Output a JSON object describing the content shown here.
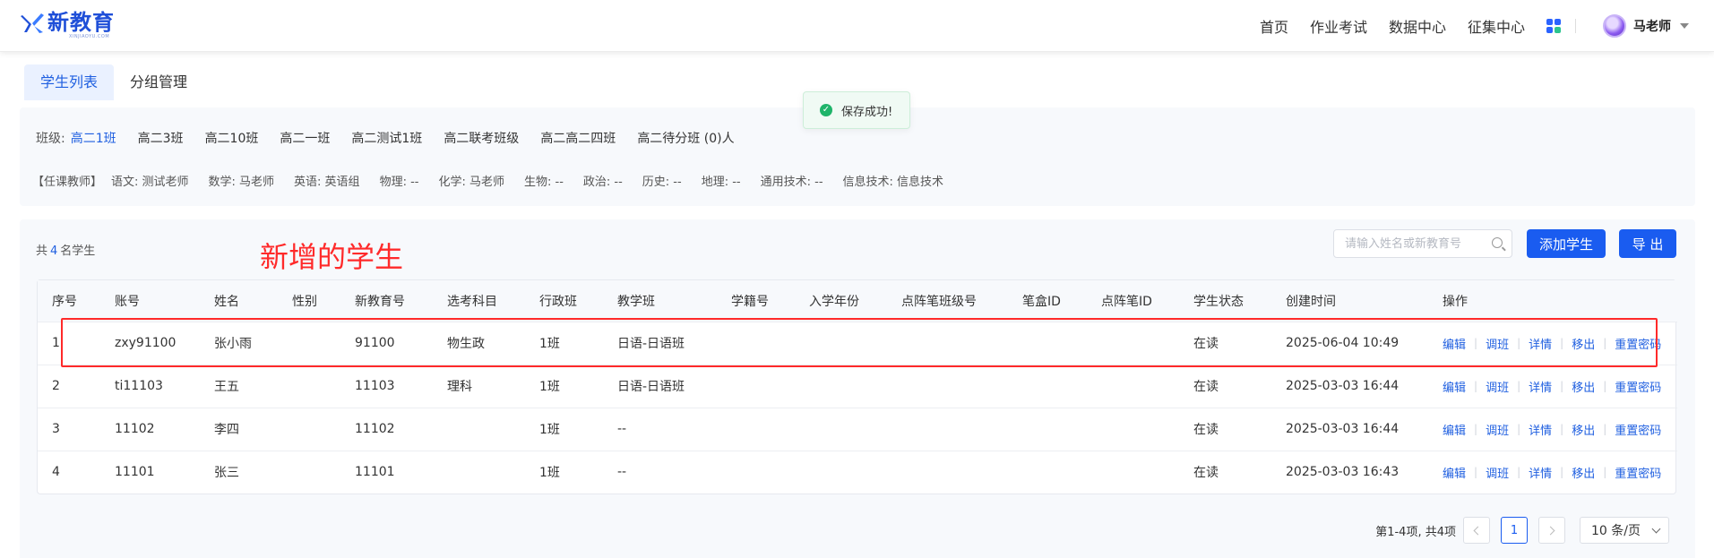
{
  "header": {
    "logo_text": "新教育",
    "logo_subtext": "XINJIAOYU.COM",
    "nav": [
      "首页",
      "作业考试",
      "数据中心",
      "征集中心"
    ],
    "user_name": "马老师"
  },
  "tabs": [
    {
      "label": "学生列表",
      "active": true
    },
    {
      "label": "分组管理",
      "active": false
    }
  ],
  "toast": {
    "message": "保存成功!"
  },
  "classes": {
    "label": "班级:",
    "items": [
      "高二1班",
      "高二3班",
      "高二10班",
      "高二一班",
      "高二测试1班",
      "高二联考班级",
      "高二高二四班",
      "高二待分班 (0)人"
    ],
    "active_index": 0
  },
  "teachers": {
    "label": "【任课教师】",
    "items": [
      "语文: 测试老师",
      "数学: 马老师",
      "英语: 英语组",
      "物理: --",
      "化学: 马老师",
      "生物: --",
      "政治: --",
      "历史: --",
      "地理: --",
      "通用技术: --",
      "信息技术: 信息技术"
    ]
  },
  "students": {
    "count_prefix": "共",
    "count": "4",
    "count_suffix": "名学生",
    "annotation": "新增的学生",
    "search_placeholder": "请输入姓名或新教育号",
    "add_button": "添加学生",
    "export_button": "导 出",
    "columns": [
      "序号",
      "账号",
      "姓名",
      "性别",
      "新教育号",
      "选考科目",
      "行政班",
      "教学班",
      "学籍号",
      "入学年份",
      "点阵笔班级号",
      "笔盒ID",
      "点阵笔ID",
      "学生状态",
      "创建时间",
      "操作"
    ],
    "rows": [
      [
        "1",
        "zxy91100",
        "张小雨",
        "",
        "91100",
        "物生政",
        "1班",
        "日语-日语班",
        "",
        "",
        "",
        "",
        "",
        "在读",
        "2025-06-04 10:49"
      ],
      [
        "2",
        "ti11103",
        "王五",
        "",
        "11103",
        "理科",
        "1班",
        "日语-日语班",
        "",
        "",
        "",
        "",
        "",
        "在读",
        "2025-03-03 16:44"
      ],
      [
        "3",
        "11102",
        "李四",
        "",
        "11102",
        "",
        "1班",
        "--",
        "",
        "",
        "",
        "",
        "",
        "在读",
        "2025-03-03 16:44"
      ],
      [
        "4",
        "11101",
        "张三",
        "",
        "11101",
        "",
        "1班",
        "--",
        "",
        "",
        "",
        "",
        "",
        "在读",
        "2025-03-03 16:43"
      ]
    ],
    "actions": [
      "编辑",
      "调班",
      "详情",
      "移出",
      "重置密码"
    ]
  },
  "pagination": {
    "summary": "第1-4项, 共4项",
    "current_page": "1",
    "page_size": "10 条/页"
  },
  "colors": {
    "primary": "#1a5cf0",
    "annotation_red": "#ff2a2a",
    "success_green": "#1fb46a"
  }
}
